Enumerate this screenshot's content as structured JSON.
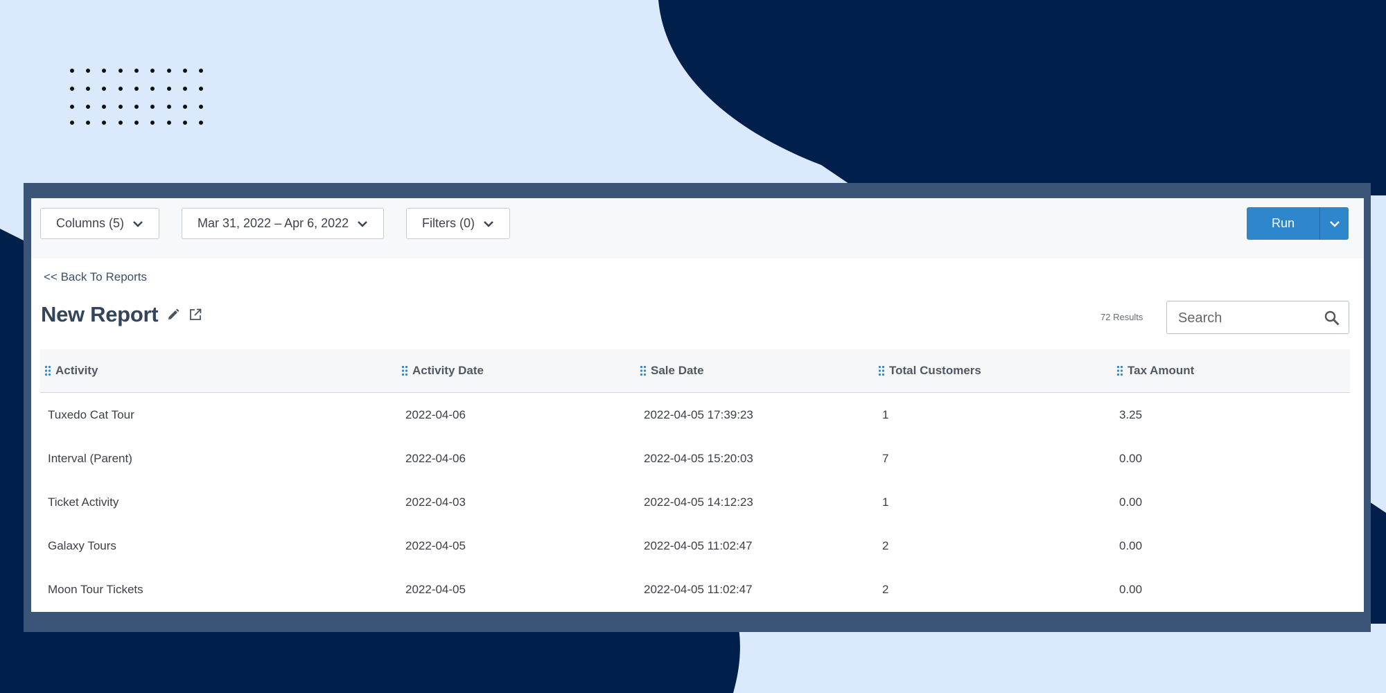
{
  "toolbar": {
    "columns_label": "Columns (5)",
    "date_range_label": "Mar 31, 2022 – Apr 6, 2022",
    "filters_label": "Filters (0)",
    "run_label": "Run"
  },
  "back_link": "<< Back To Reports",
  "report_title": "New Report",
  "results_count": "72 Results",
  "search": {
    "placeholder": "Search"
  },
  "table": {
    "headers": [
      "Activity",
      "Activity Date",
      "Sale Date",
      "Total Customers",
      "Tax Amount"
    ],
    "rows": [
      [
        "Tuxedo Cat Tour",
        "2022-04-06",
        "2022-04-05 17:39:23",
        "1",
        "3.25"
      ],
      [
        "Interval (Parent)",
        "2022-04-06",
        "2022-04-05 15:20:03",
        "7",
        "0.00"
      ],
      [
        "Ticket Activity",
        "2022-04-03",
        "2022-04-05 14:12:23",
        "1",
        "0.00"
      ],
      [
        "Galaxy Tours",
        "2022-04-05",
        "2022-04-05 11:02:47",
        "2",
        "0.00"
      ],
      [
        "Moon Tour Tickets",
        "2022-04-05",
        "2022-04-05 11:02:47",
        "2",
        "0.00"
      ]
    ]
  },
  "icons": {
    "edit": "pencil-icon",
    "open": "external-link-icon",
    "search": "search-icon",
    "grip": "drag-handle-icon"
  },
  "colors": {
    "background": "#dbe9fc",
    "navy": "#001f4b",
    "accent": "#2e87cd"
  }
}
